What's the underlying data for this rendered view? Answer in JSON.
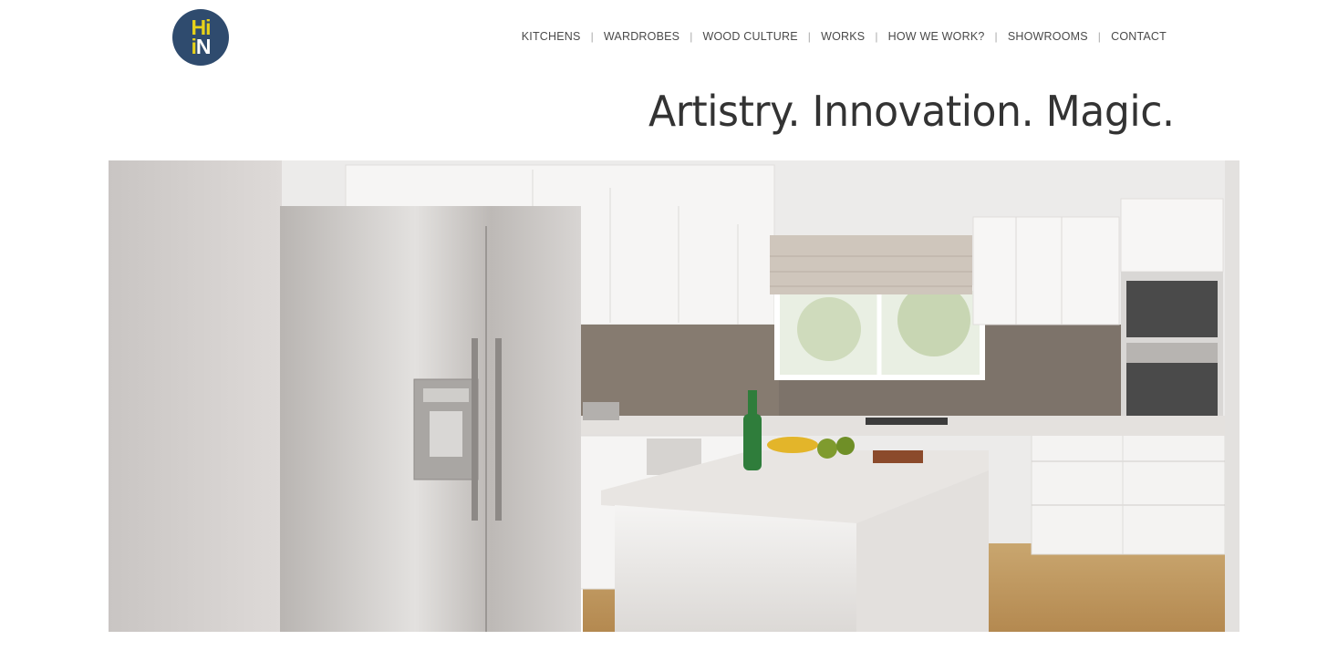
{
  "logo": {
    "line1": "Hi",
    "line2_a": "i",
    "line2_b": "N"
  },
  "nav": {
    "items": [
      "KITCHENS",
      "WARDROBES",
      "WOOD CULTURE",
      "WORKS",
      "HOW WE WORK?",
      "SHOWROOMS",
      "CONTACT"
    ],
    "separator": "|"
  },
  "tagline": "Artistry. Innovation. Magic.",
  "colors": {
    "logo_bg": "#2f4b6e",
    "logo_accent": "#e7d21a",
    "nav_text": "#4a4a4a"
  }
}
